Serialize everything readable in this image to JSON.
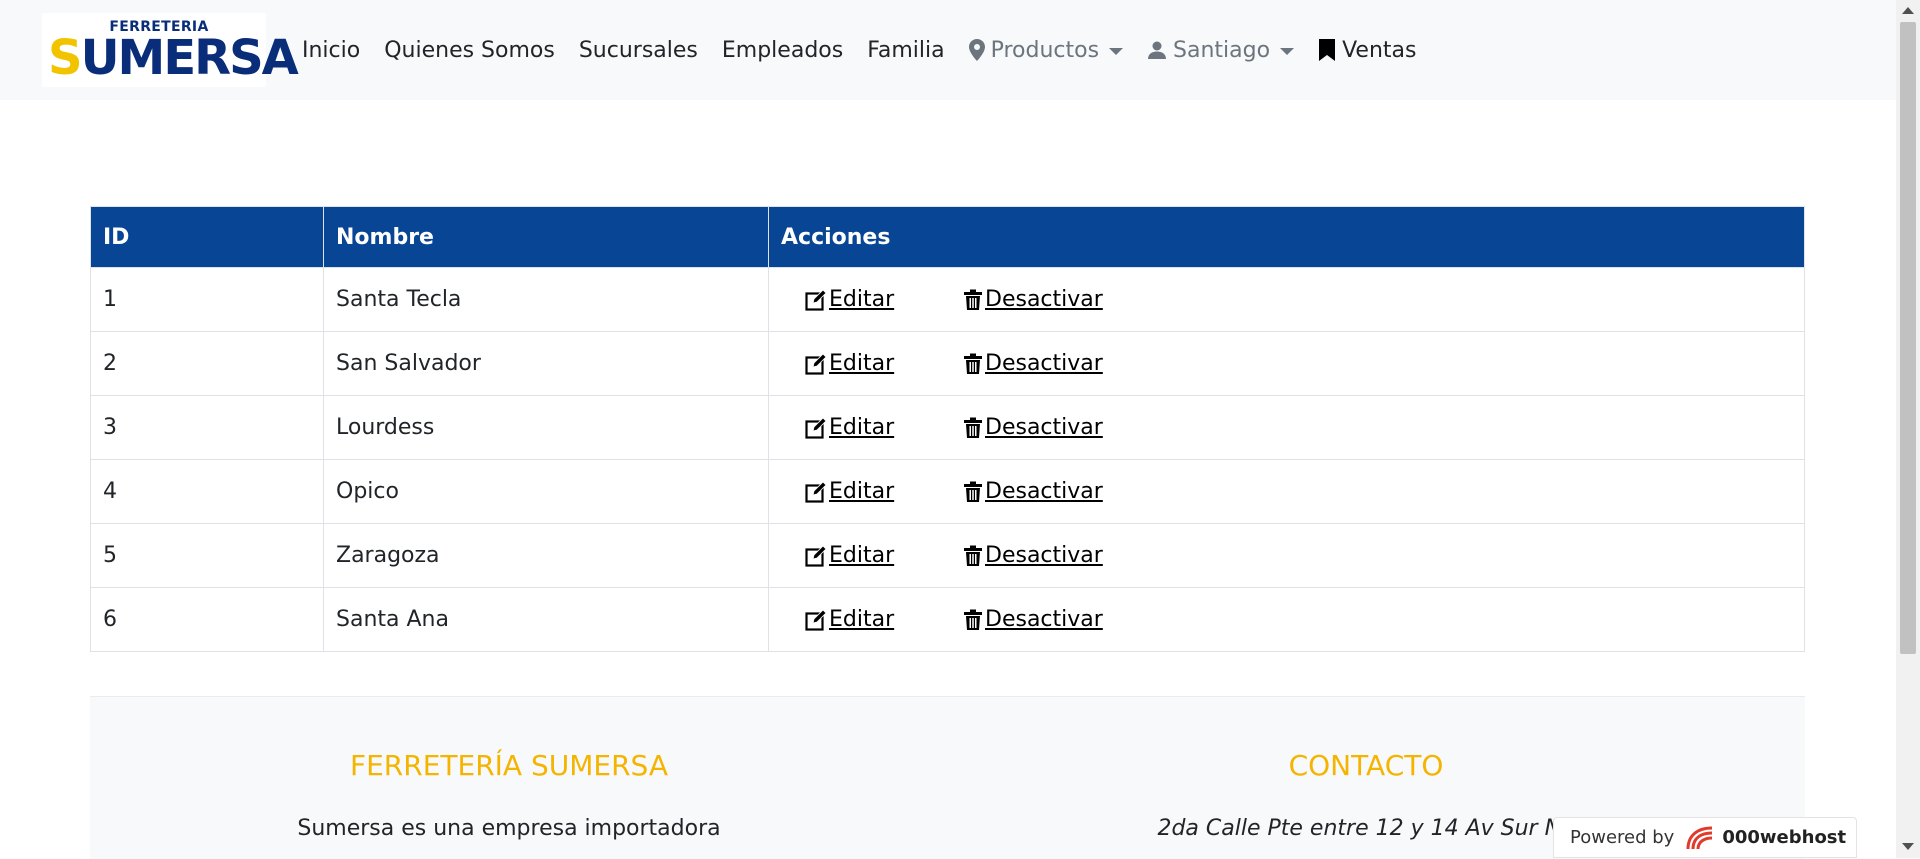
{
  "logo": {
    "small_text": "FERRETERIA",
    "big_text_s": "S",
    "big_text_rest": "UMERSA"
  },
  "nav": {
    "items": [
      {
        "label": "Inicio"
      },
      {
        "label": "Quienes Somos"
      },
      {
        "label": "Sucursales"
      },
      {
        "label": "Empleados"
      },
      {
        "label": "Familia"
      },
      {
        "label": "Productos",
        "icon": "map-marker-icon",
        "dropdown": true
      },
      {
        "label": "Santiago",
        "icon": "user-icon",
        "dropdown": true
      },
      {
        "label": "Ventas",
        "icon": "bookmark-icon"
      }
    ]
  },
  "table": {
    "headers": [
      "ID",
      "Nombre",
      "Acciones"
    ],
    "edit_label": " Editar",
    "deactivate_label": " Desactivar",
    "rows": [
      {
        "id": "1",
        "name": "Santa Tecla"
      },
      {
        "id": "2",
        "name": "San Salvador"
      },
      {
        "id": "3",
        "name": "Lourdess"
      },
      {
        "id": "4",
        "name": "Opico"
      },
      {
        "id": "5",
        "name": "Zaragoza"
      },
      {
        "id": "6",
        "name": "Santa Ana"
      }
    ],
    "header_color": "#084594"
  },
  "footer": {
    "left_title": "FERRETERÍA SUMERSA",
    "left_text": "Sumersa es una empresa importadora",
    "right_title": "CONTACTO",
    "right_text": "2da Calle Pte entre 12 y 14 Av Sur No",
    "title_color": "#f4b400"
  },
  "powered": {
    "prefix": "Powered by",
    "brand": "000webhost"
  }
}
